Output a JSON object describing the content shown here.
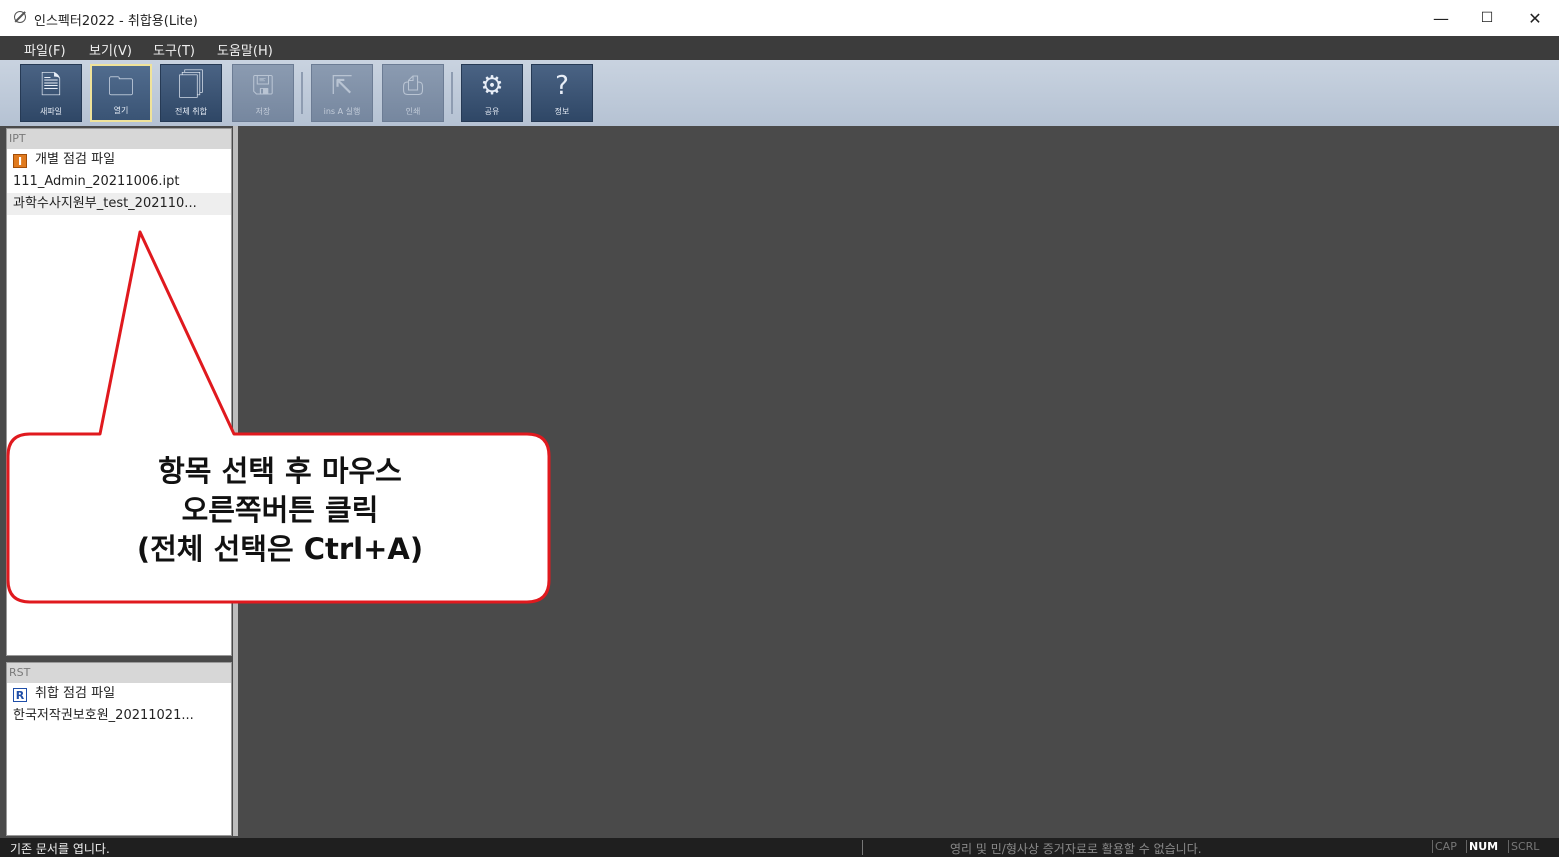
{
  "window": {
    "title": "인스펙터2022 - 취합용(Lite)",
    "controls": [
      "—",
      "☐",
      "✕"
    ]
  },
  "menu": [
    "파일(F)",
    "보기(V)",
    "도구(T)",
    "도움말(H)"
  ],
  "toolbar": [
    {
      "label": "새파일",
      "icon": "new-file-icon",
      "glyph": "🗎",
      "state": "normal"
    },
    {
      "label": "열기",
      "icon": "folder-icon",
      "glyph": "🗀",
      "state": "active"
    },
    {
      "label": "전체 취합",
      "icon": "merge-icon",
      "glyph": "🗍",
      "state": "normal"
    },
    {
      "label": "저장",
      "icon": "save-icon",
      "glyph": "🖫",
      "state": "disabled"
    },
    {
      "label": "ins A 실행",
      "icon": "run-icon",
      "glyph": "⇱",
      "state": "disabled"
    },
    {
      "label": "인쇄",
      "icon": "printer-icon",
      "glyph": "⎙",
      "state": "disabled"
    },
    {
      "label": "공유",
      "icon": "share-icon",
      "glyph": "⚙",
      "state": "normal"
    },
    {
      "label": "정보",
      "icon": "help-icon",
      "glyph": "?",
      "state": "normal"
    }
  ],
  "ipt_panel": {
    "header": "IPT",
    "group_label": "개별 점검 파일",
    "group_badge": "I",
    "files": [
      "111_Admin_20211006.ipt",
      "과학수사지원부_test_202110..."
    ]
  },
  "rst_panel": {
    "header": "RST",
    "group_label": "취합 점검 파일",
    "group_badge": "R",
    "files": [
      "한국저작권보호원_20211021..."
    ]
  },
  "callout": {
    "line1": "항목 선택 후 마우스",
    "line2": "오른쪽버튼 클릭",
    "line3": "(전체 선택은 Ctrl+A)",
    "border_color": "#e0191e"
  },
  "status": {
    "message": "기존 문서를 엽니다.",
    "notice": "영리 및 민/형사상 증거자료로 활용할 수 없습니다.",
    "indicators": {
      "cap": "CAP",
      "num": "NUM",
      "scrl": "SCRL"
    }
  }
}
